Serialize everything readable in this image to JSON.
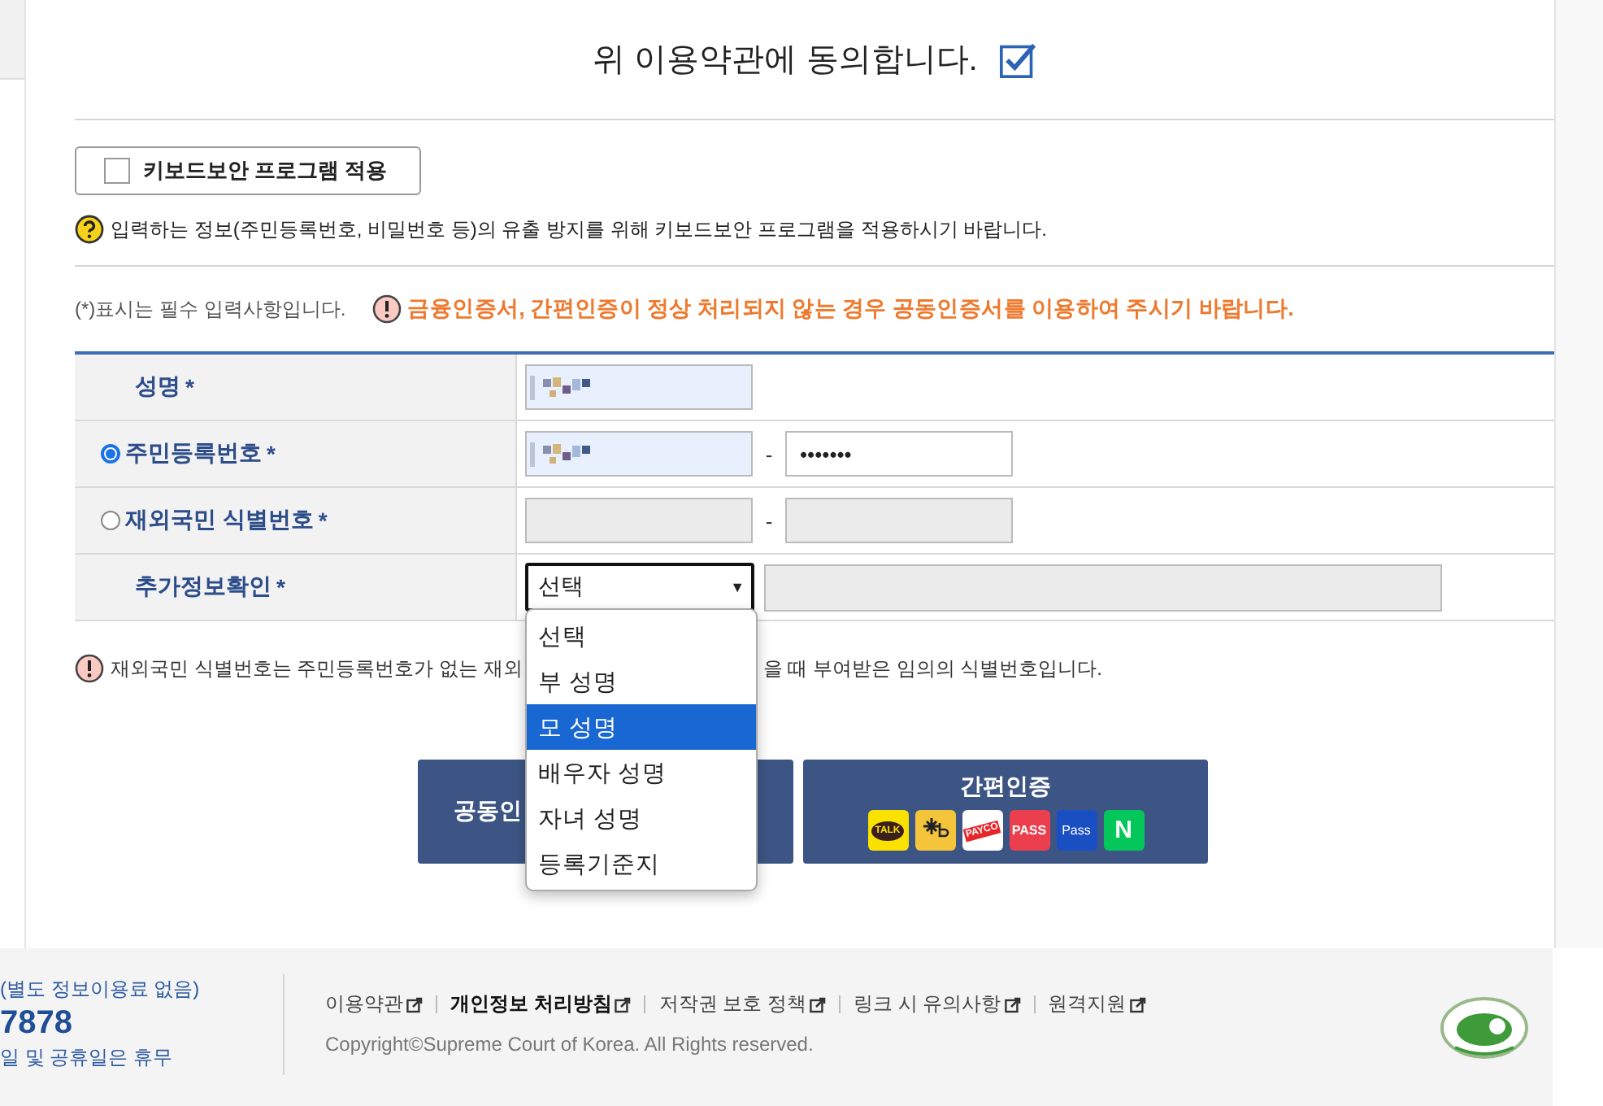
{
  "agreement": {
    "text": "위 이용약관에 동의합니다.",
    "checked": true
  },
  "keyboard_security": {
    "label": "키보드보안 프로그램 적용",
    "checked": false
  },
  "help_text": "입력하는 정보(주민등록번호, 비밀번호 등)의 유출 방지를 위해 키보드보안 프로그램을 적용하시기 바랍니다.",
  "required_note": "(*)표시는 필수 입력사항입니다.",
  "warning": "금융인증서, 간편인증이 정상 처리되지 않는 경우 공동인증서를 이용하여 주시기 바랍니다.",
  "form_rows": [
    {
      "kind": "name",
      "label": "성명",
      "mark": "*"
    },
    {
      "kind": "radio",
      "label": "주민등록번호",
      "mark": "*",
      "selected": true,
      "separator": "-",
      "second_value": "•••••••",
      "disabled": false
    },
    {
      "kind": "radio",
      "label": "재외국민 식별번호",
      "mark": "*",
      "selected": false,
      "separator": "-",
      "disabled": true
    },
    {
      "kind": "select",
      "label": "추가정보확인",
      "mark": "*",
      "value": "선택",
      "caret": "▼"
    }
  ],
  "dropdown": [
    {
      "label": "선택",
      "selected": false
    },
    {
      "label": "부 성명",
      "selected": false
    },
    {
      "label": "모 성명",
      "selected": true
    },
    {
      "label": "배우자 성명",
      "selected": false
    },
    {
      "label": "자녀 성명",
      "selected": false
    },
    {
      "label": "등록기준지",
      "selected": false
    }
  ],
  "notice": {
    "start": "재외국민 식별번호는 주민등록번호가 없는 재외",
    "end": "을 때 부여받은 임의의 식별번호입니다."
  },
  "buttons": [
    {
      "kind": "cert",
      "label": "공동인"
    },
    {
      "kind": "simple",
      "label": "간편인증",
      "badges": [
        {
          "kind": "kakao",
          "text": "TALK"
        },
        {
          "kind": "kb"
        },
        {
          "kind": "payco",
          "text": "PAYCO"
        },
        {
          "kind": "pass",
          "text": "PASS"
        },
        {
          "kind": "spass",
          "text": "Pass"
        },
        {
          "kind": "naver",
          "text": "N"
        }
      ]
    }
  ],
  "footer": {
    "lines": [
      "(별도 정보이용료 없음)",
      "7878",
      "일 및 공휴일은 휴무"
    ],
    "links": [
      {
        "label": "이용약관",
        "bold": false
      },
      {
        "label": "개인정보 처리방침",
        "bold": true
      },
      {
        "label": "저작권 보호 정책",
        "bold": false
      },
      {
        "label": "링크 시 유의사항",
        "bold": false
      },
      {
        "label": "원격지원",
        "bold": false
      }
    ],
    "copyright": "Copyright©Supreme Court of Korea. All Rights reserved."
  }
}
